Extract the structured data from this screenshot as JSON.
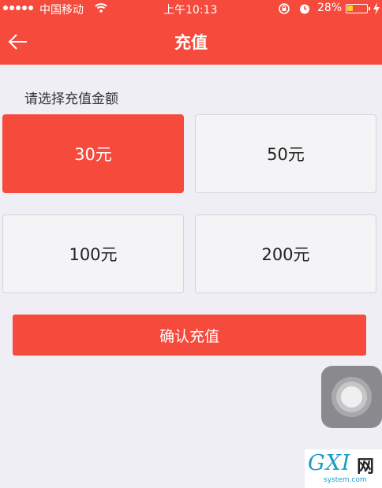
{
  "status_bar": {
    "carrier": "中国移动",
    "time": "上午10:13",
    "battery_percent": "28%",
    "battery_level": 0.28,
    "icons": [
      "signal-dots-icon",
      "wifi-icon",
      "rotation-lock-icon",
      "alarm-icon",
      "battery-icon",
      "charging-icon"
    ]
  },
  "nav": {
    "title": "充值",
    "back_icon": "back-arrow-icon"
  },
  "recharge": {
    "prompt": "请选择充值金额",
    "options": [
      {
        "label": "30元",
        "selected": true
      },
      {
        "label": "50元",
        "selected": false
      },
      {
        "label": "100元",
        "selected": false
      },
      {
        "label": "200元",
        "selected": false
      }
    ],
    "confirm_label": "确认充值"
  },
  "watermark": {
    "logo": "GXI",
    "net": "网",
    "domain": "system.com"
  },
  "colors": {
    "accent": "#f54a3c",
    "background": "#efeef4",
    "option_border": "#d4d4da",
    "battery_fill": "#ffd21f",
    "watermark_blue": "#1a9ac9"
  }
}
